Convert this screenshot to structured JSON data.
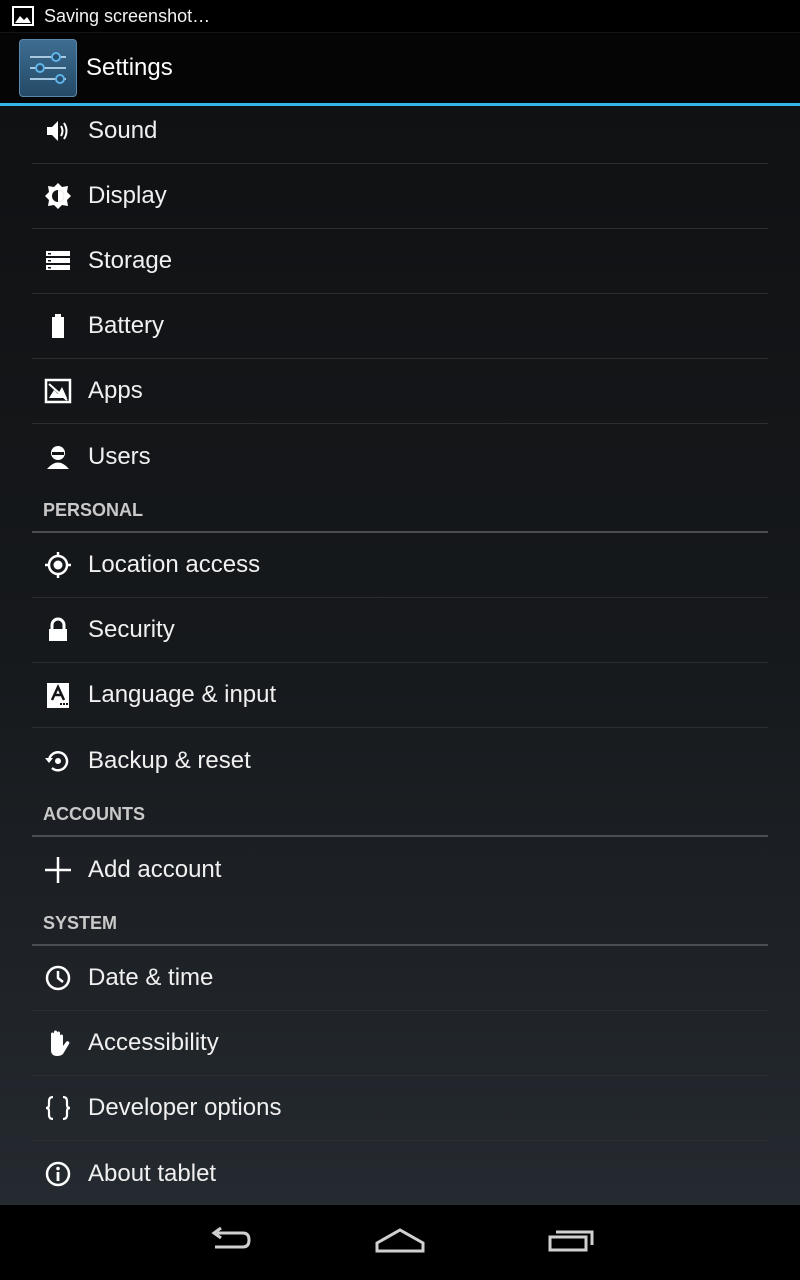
{
  "status_bar": {
    "notification_icon": "image-icon",
    "notification_text": "Saving screenshot…"
  },
  "action_bar": {
    "app_icon": "settings-sliders-icon",
    "title": "Settings"
  },
  "sections": {
    "device": [
      {
        "label": "Sound",
        "icon": "speaker-icon"
      },
      {
        "label": "Display",
        "icon": "brightness-icon"
      },
      {
        "label": "Storage",
        "icon": "storage-icon"
      },
      {
        "label": "Battery",
        "icon": "battery-icon"
      },
      {
        "label": "Apps",
        "icon": "apps-icon"
      },
      {
        "label": "Users",
        "icon": "user-icon"
      }
    ],
    "personal": {
      "header": "PERSONAL",
      "items": [
        {
          "label": "Location access",
          "icon": "location-icon"
        },
        {
          "label": "Security",
          "icon": "lock-icon"
        },
        {
          "label": "Language & input",
          "icon": "keyboard-a-icon"
        },
        {
          "label": "Backup & reset",
          "icon": "backup-icon"
        }
      ]
    },
    "accounts": {
      "header": "ACCOUNTS",
      "items": [
        {
          "label": "Add account",
          "icon": "plus-icon"
        }
      ]
    },
    "system": {
      "header": "SYSTEM",
      "items": [
        {
          "label": "Date & time",
          "icon": "clock-icon"
        },
        {
          "label": "Accessibility",
          "icon": "hand-icon"
        },
        {
          "label": "Developer options",
          "icon": "braces-icon"
        },
        {
          "label": "About tablet",
          "icon": "info-icon"
        }
      ]
    }
  },
  "nav_bar": {
    "back": "back-icon",
    "home": "home-icon",
    "recents": "recents-icon"
  },
  "colors": {
    "accent": "#33b5e5",
    "background_top": "#101113",
    "background_bottom": "#252a30",
    "text": "#f0f0f0",
    "header_text": "#c9c9c9"
  }
}
